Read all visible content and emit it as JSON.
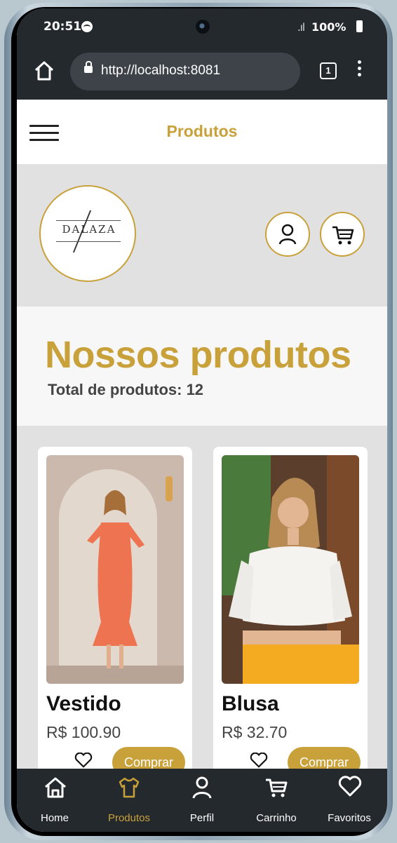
{
  "status_bar": {
    "time": "20:51",
    "signal": ".ıl",
    "battery": "100%"
  },
  "browser": {
    "url": "http://localhost:8081",
    "tab_count": "1"
  },
  "header": {
    "title": "Produtos"
  },
  "brand": {
    "logo_text": "DALAZA"
  },
  "section": {
    "title": "Nossos produtos",
    "total_label": "Total de produtos: 12"
  },
  "products": [
    {
      "name": "Vestido",
      "price": "R$ 100.90",
      "buy_label": "Comprar",
      "image": "orange-dress-photo"
    },
    {
      "name": "Blusa",
      "price": "R$ 32.70",
      "buy_label": "Comprar",
      "image": "white-blouse-photo"
    }
  ],
  "bottom_nav": {
    "items": [
      {
        "label": "Home",
        "icon": "home-icon"
      },
      {
        "label": "Produtos",
        "icon": "shirt-icon",
        "active": true
      },
      {
        "label": "Perfil",
        "icon": "user-icon"
      },
      {
        "label": "Carrinho",
        "icon": "cart-icon"
      },
      {
        "label": "Favoritos",
        "icon": "heart-icon"
      }
    ]
  },
  "colors": {
    "accent": "#c9a13a",
    "dark": "#24292e",
    "background": "#e1e1e1"
  }
}
